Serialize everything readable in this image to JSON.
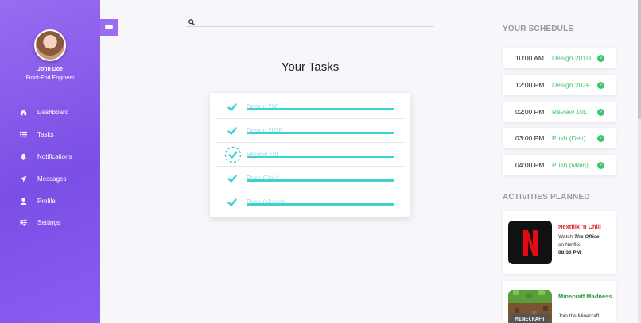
{
  "user": {
    "name": "John Doe",
    "role": "Front-End Engineer"
  },
  "nav": {
    "items": [
      {
        "label": "Dashboard",
        "icon": "home-icon",
        "glyph": "⌂"
      },
      {
        "label": "Tasks",
        "icon": "list-icon",
        "glyph": "☰"
      },
      {
        "label": "Notifications",
        "icon": "bell-icon",
        "glyph": "🔔"
      },
      {
        "label": "Messages",
        "icon": "send-icon",
        "glyph": "➤"
      },
      {
        "label": "Profile",
        "icon": "user-icon",
        "glyph": "●"
      },
      {
        "label": "Settings",
        "icon": "sliders-icon",
        "glyph": "≡"
      }
    ]
  },
  "search": {
    "placeholder": "",
    "value": ""
  },
  "tasks": {
    "title": "Your Tasks",
    "items": [
      {
        "label": "Design 200",
        "done": true
      },
      {
        "label": "Design 202F",
        "done": true
      },
      {
        "label": "Review 10L",
        "done": true,
        "highlighted": true
      },
      {
        "label": "Push (Dev)",
        "done": true
      },
      {
        "label": "Push (Master)",
        "done": true
      }
    ]
  },
  "schedule": {
    "title": "YOUR SCHEDULE",
    "items": [
      {
        "time": "10:00 AM",
        "event": "Design 201D"
      },
      {
        "time": "12:00 PM",
        "event": "Design 202F"
      },
      {
        "time": "02:00 PM",
        "event": "Review 10L"
      },
      {
        "time": "03:00 PM",
        "event": "Push (Dev)"
      },
      {
        "time": "04:00 PM",
        "event": "Push (Main)"
      }
    ]
  },
  "activities": {
    "title": "ACTIVITIES PLANNED",
    "items": [
      {
        "title": "Nextflix 'n Chill",
        "desc_pre": "Watch ",
        "desc_em": "The Office",
        "desc_post": " on Netflix.",
        "time": "08:30 PM",
        "title_color": "#e02424",
        "thumb_label": "N"
      },
      {
        "title": "Minecraft Madness",
        "desc_pre": "Join the Minecraft",
        "desc_em": "",
        "desc_post": "",
        "time": "",
        "title_color": "#2f9a3e",
        "thumb_label": "MINECRAFT"
      }
    ]
  },
  "colors": {
    "accent": "#8b5cf0",
    "teal": "#3ed1d1",
    "green": "#3fc46b",
    "red": "#e02424"
  }
}
